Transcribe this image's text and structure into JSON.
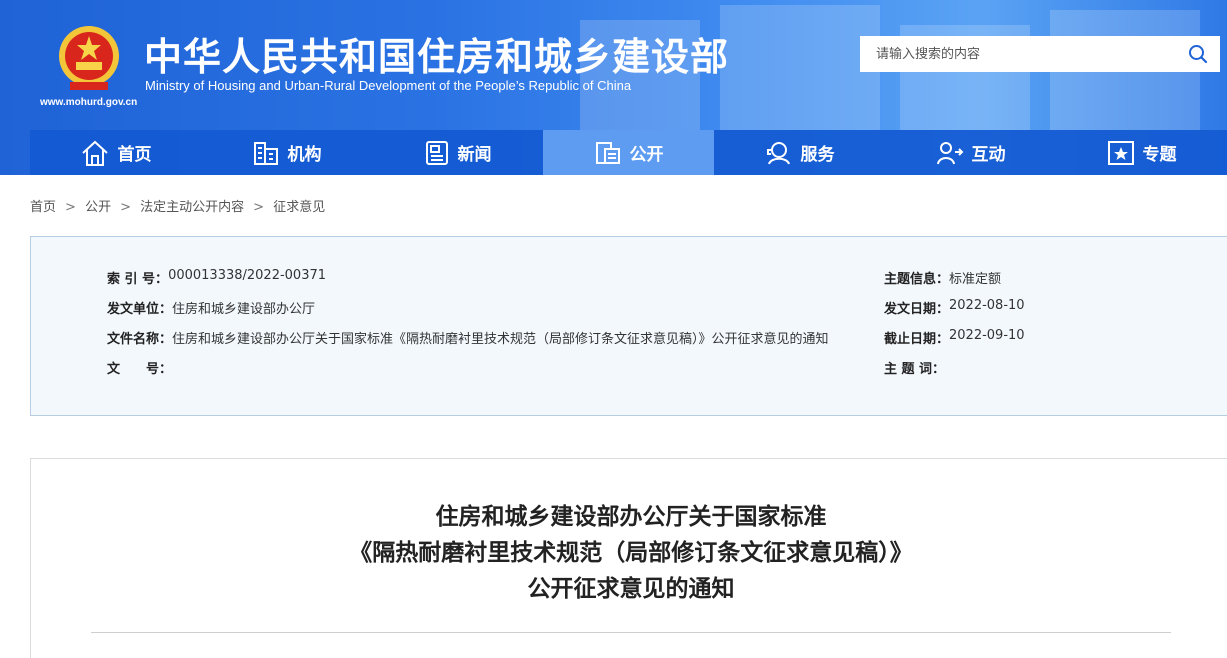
{
  "header": {
    "site_url": "www.mohurd.gov.cn",
    "title": "中华人民共和国住房和城乡建设部",
    "subtitle": "Ministry of Housing and Urban-Rural Development of the People’s Republic of China",
    "search_placeholder": "请输入搜索的内容"
  },
  "nav": [
    {
      "label": "首页",
      "icon": "home-icon"
    },
    {
      "label": "机构",
      "icon": "building-icon"
    },
    {
      "label": "新闻",
      "icon": "news-icon"
    },
    {
      "label": "公开",
      "icon": "document-icon",
      "active": true
    },
    {
      "label": "服务",
      "icon": "service-icon"
    },
    {
      "label": "互动",
      "icon": "interact-icon"
    },
    {
      "label": "专题",
      "icon": "star-icon"
    }
  ],
  "breadcrumb": [
    "首页",
    "公开",
    "法定主动公开内容",
    "征求意见"
  ],
  "info": {
    "index_label": "索 引 号：",
    "index_value": "000013338/2022-00371",
    "issuer_label": "发文单位：",
    "issuer_value": "住房和城乡建设部办公厅",
    "filename_label": "文件名称：",
    "filename_value": "住房和城乡建设部办公厅关于国家标准《隔热耐磨衬里技术规范（局部修订条文征求意见稿）》公开征求意见的通知",
    "docno_label": "文　　号：",
    "docno_value": "",
    "topic_label": "主题信息：",
    "topic_value": "标准定额",
    "date_label": "发文日期：",
    "date_value": "2022-08-10",
    "deadline_label": "截止日期：",
    "deadline_value": "2022-09-10",
    "keywords_label": "主 题 词：",
    "keywords_value": ""
  },
  "article": {
    "title_line1": "住房和城乡建设部办公厅关于国家标准",
    "title_line2": "《隔热耐磨衬里技术规范（局部修订条文征求意见稿）》",
    "title_line3": "公开征求意见的通知"
  },
  "colors": {
    "header_blue": "#2a72e3",
    "nav_blue": "#145ad2",
    "nav_active": "#5d9cf1",
    "info_bg": "#f3f8fd"
  }
}
